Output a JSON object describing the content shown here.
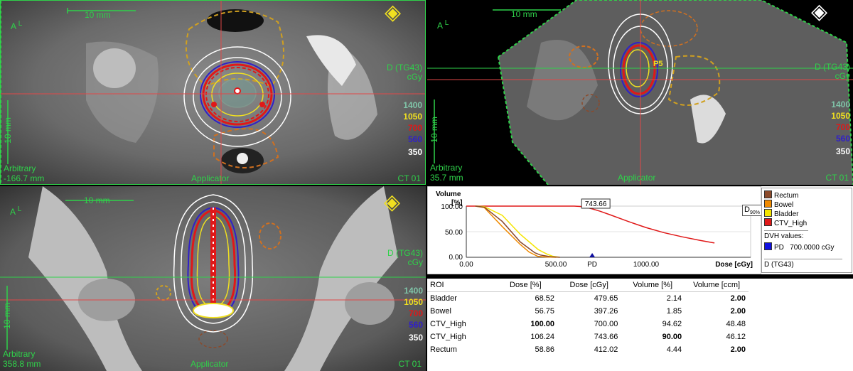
{
  "views": [
    {
      "id": "axial",
      "orientation_top": "A",
      "orientation_side": "L",
      "scale_label": "10 mm",
      "scale_label_vertical": "10 mm",
      "dose_title": "D (TG43)",
      "dose_unit": "cGy",
      "isodose_levels": [
        "1400",
        "1050",
        "700",
        "560",
        "350"
      ],
      "plane_name": "Arbitrary",
      "plane_position": "-166.7 mm",
      "applicator_label": "Applicator",
      "dataset": "CT 01"
    },
    {
      "id": "sagittal",
      "orientation_top": "A",
      "orientation_side": "L",
      "scale_label": "10 mm",
      "scale_label_vertical": "10 mm",
      "dose_title": "D (TG43)",
      "dose_unit": "cGy",
      "isodose_levels": [
        "1400",
        "1050",
        "700",
        "560",
        "350"
      ],
      "plane_name": "Arbitrary",
      "plane_position": "35.7 mm",
      "applicator_label": "Applicator",
      "dataset": "CT 01",
      "point_label": "P5"
    },
    {
      "id": "coronal",
      "orientation_top": "A",
      "orientation_side": "L",
      "scale_label": "10 mm",
      "scale_label_vertical": "10 mm",
      "dose_title": "D (TG43)",
      "dose_unit": "cGy",
      "isodose_levels": [
        "1400",
        "1050",
        "700",
        "560",
        "350"
      ],
      "plane_name": "Arbitrary",
      "plane_position": "358.8 mm",
      "applicator_label": "Applicator",
      "dataset": "CT 01"
    }
  ],
  "isodose_colors": {
    "1400": "#7fc4a8",
    "1050": "#f0e020",
    "700": "#e01818",
    "560": "#3020c8",
    "350": "#ffffff"
  },
  "dvh": {
    "y_title": "Volume",
    "y_unit": "[%]",
    "y_ticks": [
      "100.00",
      "50.00",
      "0.00"
    ],
    "x_ticks": [
      "0.00",
      "500.00",
      "1000.00"
    ],
    "x_title": "Dose [cGy]",
    "pd_marker": "PD",
    "annotation_value": "743.66",
    "d90_label": "D",
    "d90_sub": "90%",
    "legend": [
      {
        "name": "Rectum",
        "color": "#8b4a2b"
      },
      {
        "name": "Bowel",
        "color": "#f08a00"
      },
      {
        "name": "Bladder",
        "color": "#f5e500"
      },
      {
        "name": "CTV_High",
        "color": "#e01818"
      }
    ],
    "dvh_values_label": "DVH values:",
    "pd_row": {
      "name": "PD",
      "value": "700.0000 cGy",
      "color": "#1010e0"
    },
    "footer_label": "D (TG43)"
  },
  "chart_data": {
    "type": "line",
    "xlabel": "Dose [cGy]",
    "ylabel": "Volume [%]",
    "xlim": [
      0,
      1500
    ],
    "ylim": [
      0,
      100
    ],
    "series": [
      {
        "name": "CTV_High",
        "x": [
          0,
          200,
          400,
          600,
          650,
          700,
          743.66,
          800,
          900,
          1000,
          1100,
          1200,
          1300,
          1380
        ],
        "y": [
          100,
          100,
          100,
          100,
          99,
          94.62,
          90,
          83,
          70,
          58,
          48,
          40,
          33,
          28
        ]
      },
      {
        "name": "Bladder",
        "x": [
          50,
          100,
          200,
          300,
          400,
          450,
          479.65,
          520
        ],
        "y": [
          100,
          99,
          82,
          45,
          15,
          6,
          2.14,
          0
        ]
      },
      {
        "name": "Bowel",
        "x": [
          50,
          100,
          200,
          300,
          350,
          397.26,
          450,
          500
        ],
        "y": [
          100,
          97,
          60,
          25,
          10,
          1.85,
          0.5,
          0
        ]
      },
      {
        "name": "Rectum",
        "x": [
          50,
          100,
          200,
          300,
          380,
          412.02,
          470,
          520
        ],
        "y": [
          100,
          98,
          70,
          30,
          9,
          4.44,
          1,
          0
        ]
      }
    ],
    "markers": [
      {
        "label": "PD",
        "x": 700
      },
      {
        "label": "743.66",
        "x": 743.66,
        "y": 90
      }
    ]
  },
  "table": {
    "headers": [
      "ROI",
      "Dose [%]",
      "Dose [cGy]",
      "Volume [%]",
      "Volume [ccm]"
    ],
    "rows": [
      {
        "roi": "Bladder",
        "dose_pct": "68.52",
        "dose_cgy": "479.65",
        "vol_pct": "2.14",
        "vol_ccm": "2.00",
        "bold": [
          false,
          false,
          false,
          true
        ]
      },
      {
        "roi": "Bowel",
        "dose_pct": "56.75",
        "dose_cgy": "397.26",
        "vol_pct": "1.85",
        "vol_ccm": "2.00",
        "bold": [
          false,
          false,
          false,
          true
        ]
      },
      {
        "roi": "CTV_High",
        "dose_pct": "100.00",
        "dose_cgy": "700.00",
        "vol_pct": "94.62",
        "vol_ccm": "48.48",
        "bold": [
          true,
          false,
          false,
          false
        ]
      },
      {
        "roi": "CTV_High",
        "dose_pct": "106.24",
        "dose_cgy": "743.66",
        "vol_pct": "90.00",
        "vol_ccm": "46.12",
        "bold": [
          false,
          false,
          true,
          false
        ]
      },
      {
        "roi": "Rectum",
        "dose_pct": "58.86",
        "dose_cgy": "412.02",
        "vol_pct": "4.44",
        "vol_ccm": "2.00",
        "bold": [
          false,
          false,
          false,
          true
        ]
      }
    ]
  }
}
